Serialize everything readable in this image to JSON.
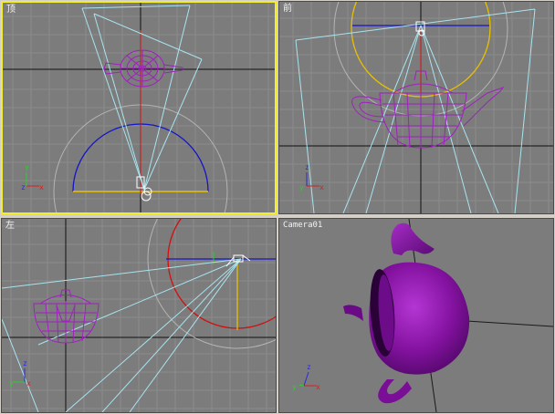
{
  "viewports": [
    {
      "id": "top",
      "label": "顶",
      "active": true
    },
    {
      "id": "front",
      "label": "前",
      "active": false
    },
    {
      "id": "left",
      "label": "左",
      "active": false
    },
    {
      "id": "camera",
      "label": "Camera01",
      "active": false
    }
  ],
  "axis_gizmo": {
    "x_label": "x",
    "y_label": "y",
    "z_label": "z",
    "colors": {
      "x": "#d62020",
      "y": "#2ad02a",
      "z": "#2a2ad8"
    }
  },
  "colors": {
    "viewport_bg": "#7c7c7c",
    "grid": "#8c8c8c",
    "axis_line": "#111111",
    "active_border": "#f2ee2a",
    "teapot_wire": "#a020c0",
    "teapot_shaded": "#8a18a6",
    "camera_cone": "#a8e4f0",
    "light_circle_red": "#d01010",
    "light_circle_blue": "#1818c0",
    "light_circle_yellow": "#e8c000",
    "range_circle": "#b8b8b8"
  }
}
